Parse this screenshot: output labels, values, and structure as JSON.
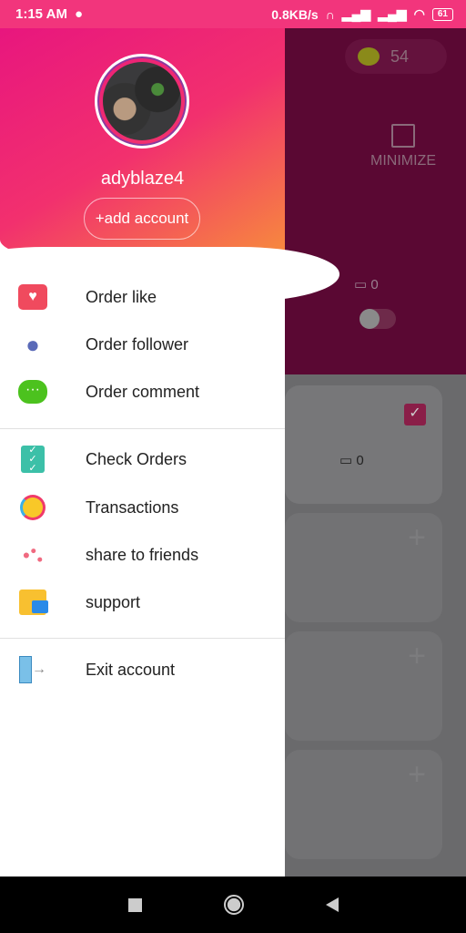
{
  "status_bar": {
    "time": "1:15 AM",
    "speed": "0.8KB/s",
    "battery": "61"
  },
  "background": {
    "coins": "54",
    "minimize_label": "MINIMIZE",
    "comment_count_1": "0",
    "comment_count_2": "0"
  },
  "drawer": {
    "username": "adyblaze4",
    "add_account": "+add account",
    "items": [
      {
        "label": "Order like",
        "icon": "heart-icon"
      },
      {
        "label": "Order follower",
        "icon": "users-icon"
      },
      {
        "label": "Order comment",
        "icon": "comment-icon"
      },
      {
        "label": "Check Orders",
        "icon": "checklist-icon"
      },
      {
        "label": "Transactions",
        "icon": "coin-exchange-icon"
      },
      {
        "label": "share to friends",
        "icon": "share-icon"
      },
      {
        "label": "support",
        "icon": "folder-mail-icon"
      },
      {
        "label": "Exit account",
        "icon": "exit-icon"
      }
    ]
  },
  "colors": {
    "status": "#f2357c",
    "accent": "#e8167e"
  }
}
